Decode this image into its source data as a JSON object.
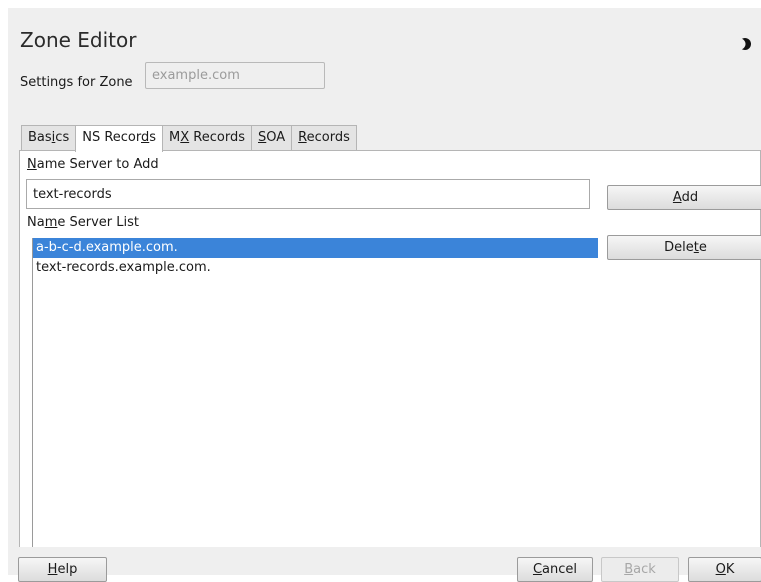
{
  "window": {
    "title": "Zone Editor"
  },
  "settings": {
    "label": "Settings for Zone",
    "zone_value": "example.com"
  },
  "tabs": [
    {
      "pre": "Bas",
      "key": "i",
      "post": "cs",
      "active": false
    },
    {
      "pre": "NS Recor",
      "key": "d",
      "post": "s",
      "active": true
    },
    {
      "pre": "M",
      "key": "X",
      "post": " Records",
      "active": false
    },
    {
      "pre": "",
      "key": "S",
      "post": "OA",
      "active": false
    },
    {
      "pre": "",
      "key": "R",
      "post": "ecords",
      "active": false
    }
  ],
  "ns_add": {
    "pre": "",
    "key": "N",
    "post": "ame Server to Add",
    "value": "text-records"
  },
  "add_button": {
    "pre": "",
    "key": "A",
    "post": "dd"
  },
  "ns_list": {
    "pre": "Na",
    "key": "m",
    "post": "e Server List",
    "items": [
      {
        "text": "a-b-c-d.example.com.",
        "selected": true
      },
      {
        "text": "text-records.example.com.",
        "selected": false
      }
    ]
  },
  "delete_button": {
    "pre": "Dele",
    "key": "t",
    "post": "e"
  },
  "footer": {
    "help": {
      "pre": "",
      "key": "H",
      "post": "elp"
    },
    "cancel": {
      "pre": "",
      "key": "C",
      "post": "ancel"
    },
    "back": {
      "pre": "",
      "key": "B",
      "post": "ack",
      "enabled": false
    },
    "ok": {
      "pre": "",
      "key": "O",
      "post": "K"
    }
  },
  "colors": {
    "selection": "#3b84d9",
    "window_bg": "#efefef"
  },
  "icons": {
    "top_right": "moon-icon"
  }
}
